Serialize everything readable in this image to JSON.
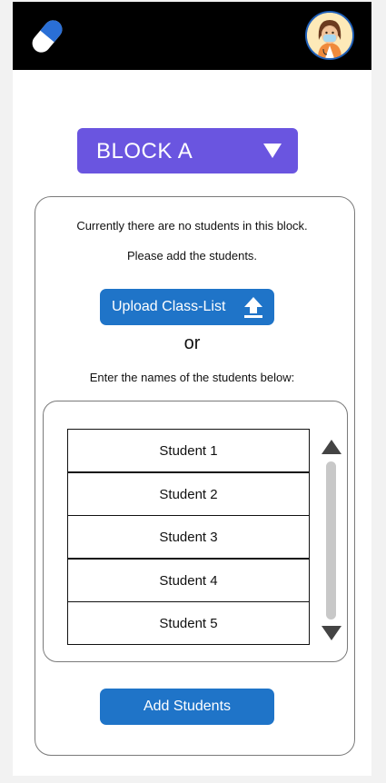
{
  "block_select": {
    "label": "BLOCK A"
  },
  "messages": {
    "no_students": "Currently there are no students in this block.",
    "please_add": "Please add the students.",
    "or": "or",
    "enter_names": "Enter the names of the students below:"
  },
  "upload": {
    "label": "Upload Class-List"
  },
  "students": [
    "Student 1",
    "Student 2",
    "Student 3",
    "Student 4",
    "Student 5"
  ],
  "add_button": {
    "label": "Add Students"
  },
  "colors": {
    "topbar": "#000000",
    "select": "#6a55e0",
    "button": "#1f74c8",
    "scroll": "#c8c8c8"
  },
  "icons": {
    "logo": "pill-icon",
    "avatar": "nurse-avatar",
    "select_caret": "caret-down-icon",
    "upload": "upload-arrow-icon",
    "scroll_up": "triangle-up-icon",
    "scroll_down": "triangle-down-icon"
  }
}
